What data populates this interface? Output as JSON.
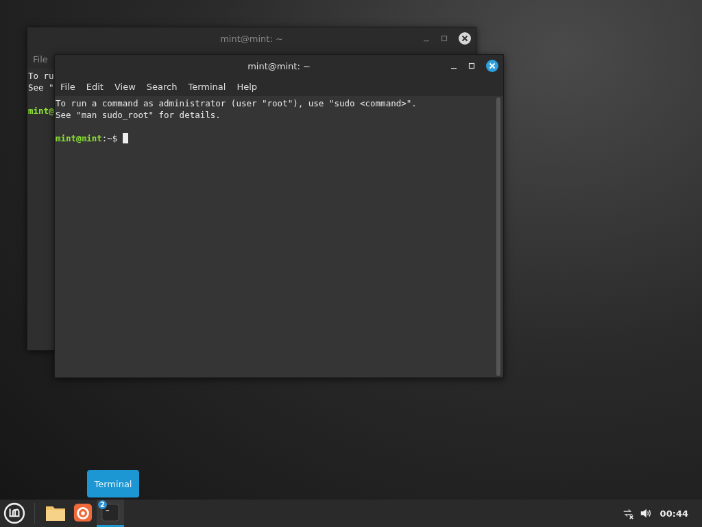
{
  "windows": [
    {
      "title": "mint@mint: ~",
      "focused": false,
      "menu": [
        "File"
      ],
      "lines": [
        {
          "kind": "text",
          "text": "To ru"
        },
        {
          "kind": "text",
          "text": "See \""
        },
        {
          "kind": "blank"
        },
        {
          "kind": "prompt",
          "user": "mint@"
        }
      ]
    },
    {
      "title": "mint@mint: ~",
      "focused": true,
      "menu": [
        "File",
        "Edit",
        "View",
        "Search",
        "Terminal",
        "Help"
      ],
      "lines": [
        {
          "kind": "text",
          "text": "To run a command as administrator (user \"root\"), use \"sudo <command>\"."
        },
        {
          "kind": "text",
          "text": "See \"man sudo_root\" for details."
        },
        {
          "kind": "blank"
        },
        {
          "kind": "prompt",
          "user": "mint@mint",
          "rest": ":~$",
          "cursor": true
        }
      ]
    }
  ],
  "tooltip": "Terminal",
  "taskbar": {
    "apps": [
      {
        "kind": "files",
        "selected": false
      },
      {
        "kind": "browser",
        "selected": false
      },
      {
        "kind": "terminal",
        "badge": "2",
        "selected": true
      }
    ],
    "clock": "00:44"
  }
}
